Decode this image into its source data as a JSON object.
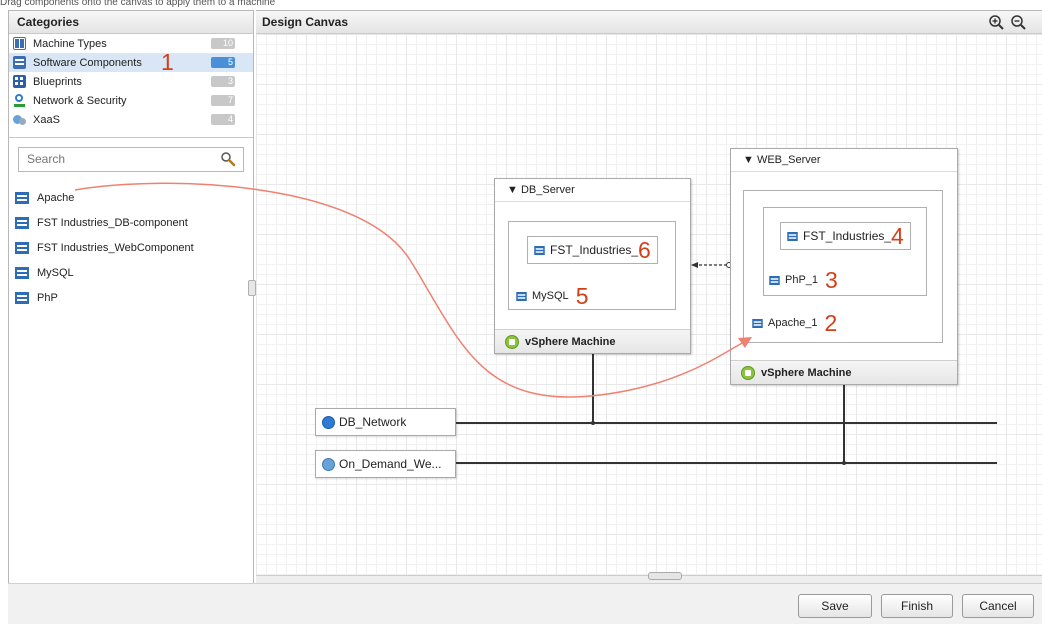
{
  "top_text": "Drag components onto the canvas to apply them to a machine",
  "categories": {
    "title": "Categories",
    "items": [
      {
        "label": "Machine Types",
        "count": "10",
        "icon": "machine-types-icon"
      },
      {
        "label": "Software Components",
        "count": "5",
        "icon": "software-components-icon",
        "selected": true,
        "annotation": "1"
      },
      {
        "label": "Blueprints",
        "count": "3",
        "icon": "blueprints-icon"
      },
      {
        "label": "Network & Security",
        "count": "7",
        "icon": "network-security-icon"
      },
      {
        "label": "XaaS",
        "count": "4",
        "icon": "xaas-icon"
      }
    ]
  },
  "search": {
    "placeholder": "Search"
  },
  "components": [
    "Apache",
    "FST Industries_DB-component",
    "FST Industries_WebComponent",
    "MySQL",
    "PhP"
  ],
  "canvas": {
    "title": "Design Canvas",
    "db_server": {
      "name": "DB_Server",
      "components": [
        {
          "label": "FST_Industries_",
          "annotation": "6"
        },
        {
          "label": "MySQL",
          "annotation": "5"
        }
      ],
      "footer": "vSphere Machine"
    },
    "web_server": {
      "name": "WEB_Server",
      "components": [
        {
          "label": "FST_Industries_",
          "annotation": "4"
        },
        {
          "label": "PhP_1",
          "annotation": "3"
        },
        {
          "label": "Apache_1",
          "annotation": "2"
        }
      ],
      "footer": "vSphere Machine"
    },
    "networks": [
      "DB_Network",
      "On_Demand_We..."
    ]
  },
  "buttons": {
    "save": "Save",
    "finish": "Finish",
    "cancel": "Cancel"
  },
  "colors": {
    "annotation": "#d2401a",
    "selection": "#d9e6f5",
    "accent": "#4a90d9",
    "drag_arrow": "#f08070"
  }
}
